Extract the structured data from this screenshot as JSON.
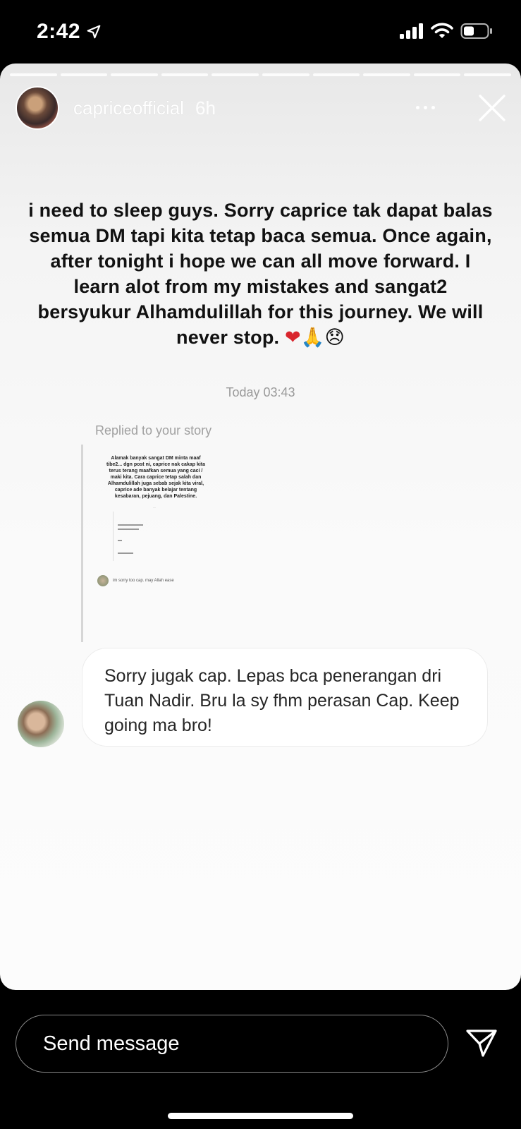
{
  "status_bar": {
    "time": "2:42",
    "icons": [
      "location-arrow-icon",
      "cellular-signal-icon",
      "wifi-icon",
      "battery-icon"
    ]
  },
  "story": {
    "username": "capriceofficial",
    "time_ago": "6h",
    "progress_segments": 10,
    "text": "i need to sleep guys. Sorry caprice tak dapat balas semua DM tapi kita tetap baca semua. Once again, after tonight i hope we can all move forward. I learn alot from my mistakes and sangat2 bersyukur Alhamdulillah for this journey. We will never stop.",
    "emojis": [
      "❤",
      "🙏",
      "😞"
    ]
  },
  "chat": {
    "timestamp": "Today 03:43",
    "replied_label": "Replied to your story",
    "thumbnail": {
      "text": "Alamak banyak sangat DM minta maaf tibe2... dgn post ni, caprice nak cakap kita terus terang maafkan semua yang caci / maki kita. Cara caprice tetap salah dan Alhamdulillah juga sebab sejak kita viral, caprice ade banyak belajar tentang kesabaran, pejuang, dan Palestine.",
      "reply": "im sorry too cap. may Allah ease"
    },
    "message": "Sorry jugak cap. Lepas bca penerangan dri Tuan Nadir. Bru la sy fhm perasan Cap. Keep going ma bro!"
  },
  "composer": {
    "placeholder": "Send message"
  }
}
